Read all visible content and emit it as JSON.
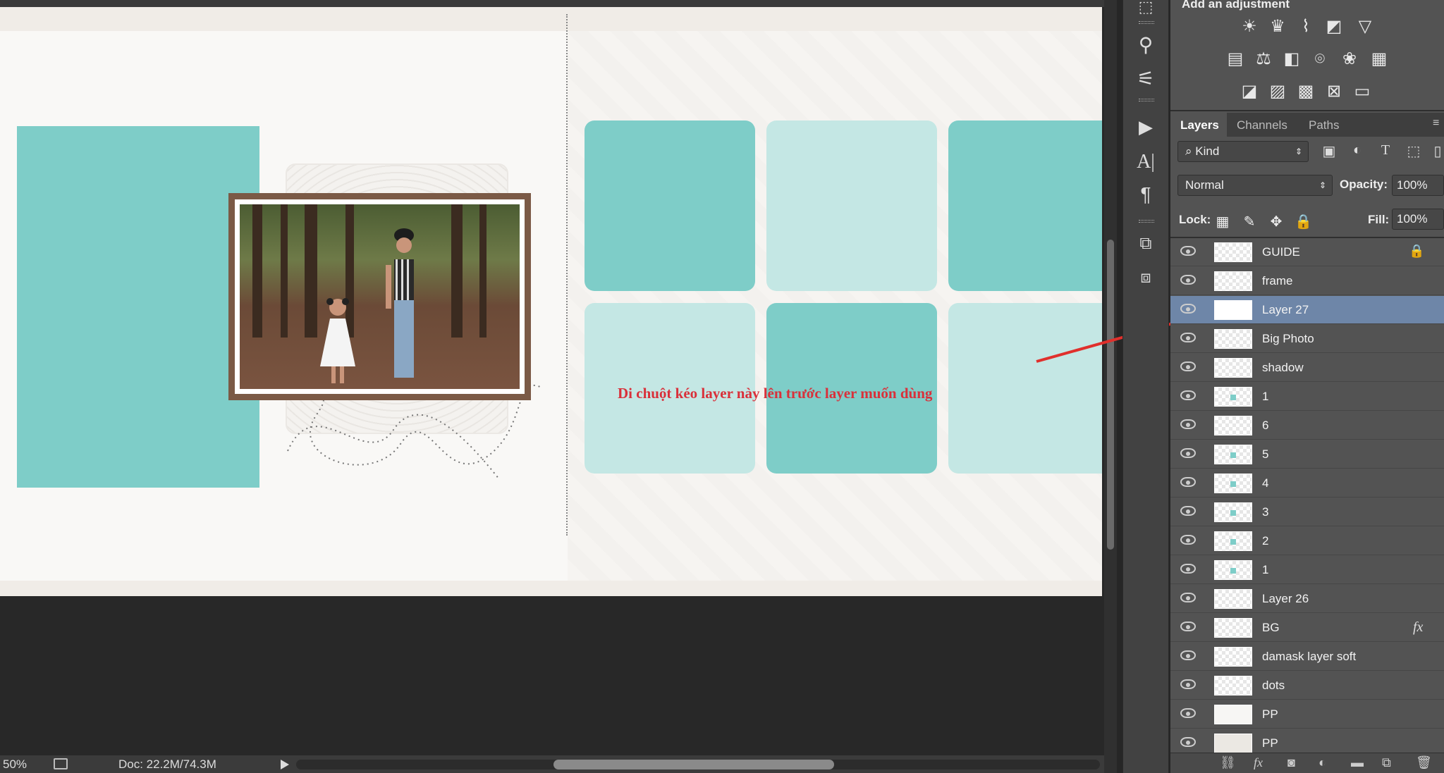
{
  "status": {
    "zoom": "50%",
    "doc_size": "Doc: 22.2M/74.3M"
  },
  "annotation": {
    "text": "Di chuột kéo layer này lên trước layer muốn dùng",
    "color": "#d9303a"
  },
  "adjustments": {
    "title": "Add an adjustment",
    "icons": [
      "brightness-icon",
      "levels-icon",
      "curves-icon",
      "exposure-icon",
      "vibrance-icon",
      "hue-saturation-icon",
      "color-balance-icon",
      "black-white-icon",
      "photo-filter-icon",
      "channel-mixer-icon",
      "color-lookup-icon",
      "invert-icon",
      "posterize-icon",
      "threshold-icon",
      "selective-color-icon",
      "gradient-map-icon"
    ]
  },
  "tabs": [
    "Layers",
    "Channels",
    "Paths"
  ],
  "filter": {
    "kind_label": "Kind"
  },
  "blend": {
    "mode": "Normal",
    "opacity_label": "Opacity:",
    "opacity_value": "100%"
  },
  "lock": {
    "label": "Lock:",
    "fill_label": "Fill:",
    "fill_value": "100%"
  },
  "layers": [
    {
      "name": "GUIDE",
      "locked": true
    },
    {
      "name": "frame"
    },
    {
      "name": "Layer 27",
      "selected": true
    },
    {
      "name": "Big Photo"
    },
    {
      "name": "shadow"
    },
    {
      "name": "1"
    },
    {
      "name": "6"
    },
    {
      "name": "5"
    },
    {
      "name": "4"
    },
    {
      "name": "3"
    },
    {
      "name": "2"
    },
    {
      "name": "1"
    },
    {
      "name": "Layer 26"
    },
    {
      "name": "BG",
      "fx": true
    },
    {
      "name": "damask layer soft"
    },
    {
      "name": "dots"
    },
    {
      "name": "PP"
    },
    {
      "name": "PP"
    }
  ],
  "colors": {
    "teal": "#7ecdc8",
    "teal_light": "#c4e7e4",
    "selection": "#6e86a8"
  }
}
